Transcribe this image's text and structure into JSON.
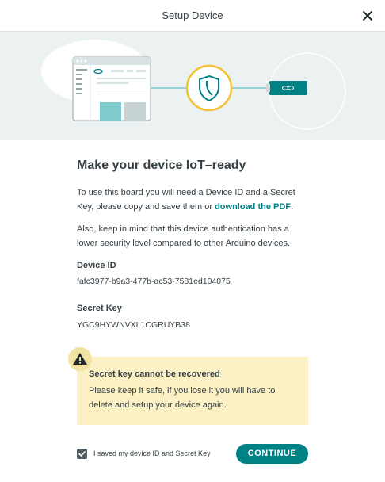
{
  "header": {
    "title": "Setup Device"
  },
  "heading": "Make your device IoT–ready",
  "intro": {
    "text": "To use this board you will need a Device ID and a Secret Key, please copy and save them or",
    "link": "download the PDF",
    "suffix": "."
  },
  "security_note": "Also, keep in mind that this device authentication has a lower security level compared to other Arduino devices.",
  "device_id": {
    "label": "Device ID",
    "value": "fafc3977-b9a3-477b-ac53-7581ed104075"
  },
  "secret_key": {
    "label": "Secret Key",
    "value": "YGC9HYWNVXL1CGRUYB38"
  },
  "warning": {
    "title": "Secret key cannot be recovered",
    "text": "Please keep it safe, if you lose it you will have to delete and setup your device again."
  },
  "footer": {
    "checkbox_label": "I saved my device ID and Secret Key",
    "checkbox_checked": true,
    "continue_label": "CONTINUE"
  },
  "colors": {
    "accent": "#008184",
    "warning_bg": "#fbf1c4",
    "hero_bg": "#ecf1f1",
    "shield_ring": "#f2c230"
  },
  "icons": [
    "close-icon",
    "browser-illustration",
    "shield-icon",
    "board-icon",
    "warning-icon",
    "check-icon"
  ]
}
